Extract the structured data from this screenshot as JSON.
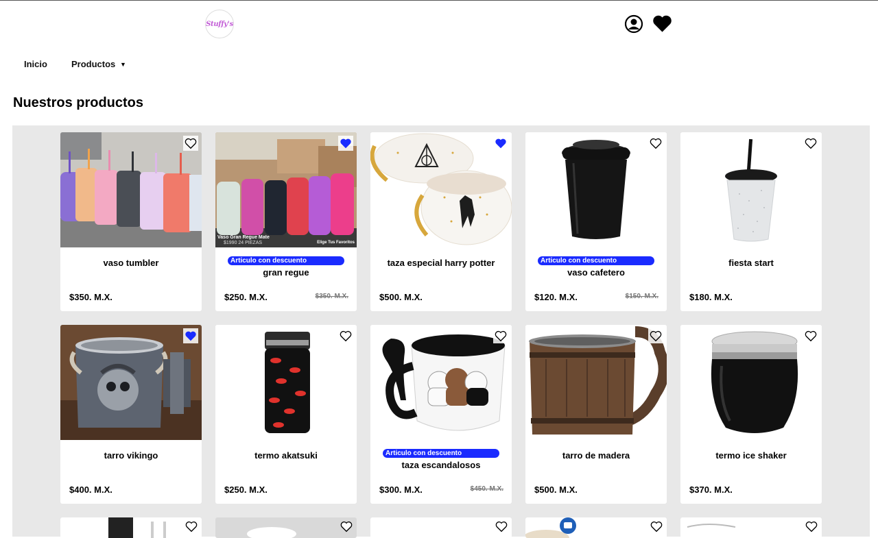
{
  "header": {
    "logo_text": "Stuffy's",
    "icons": [
      "user-circle-icon",
      "heart-icon"
    ]
  },
  "nav": {
    "inicio": "Inicio",
    "productos": "Productos",
    "caret": "▼"
  },
  "page_title": "Nuestros productos",
  "products": [
    {
      "name": "vaso tumbler",
      "price": "$350. M.X.",
      "favorite": false,
      "discount": false
    },
    {
      "name": "gran regue",
      "price": "$250. M.X.",
      "old_price": "$350. M.X.",
      "favorite": true,
      "discount": true,
      "badge": "Articulo con descuento",
      "img_caption": "Vaso Gran Regue Mate",
      "img_sub": "$1990 24 PIEZAS",
      "img_tag": "Elige Tus Favoritos"
    },
    {
      "name": "taza especial harry potter",
      "price": "$500. M.X.",
      "favorite": true,
      "discount": false
    },
    {
      "name": "vaso cafetero",
      "price": "$120. M.X.",
      "old_price": "$150. M.X.",
      "favorite": false,
      "discount": true,
      "badge": "Articulo con descuento"
    },
    {
      "name": "fiesta start",
      "price": "$180. M.X.",
      "favorite": false,
      "discount": false
    },
    {
      "name": "tarro vikingo",
      "price": "$400. M.X.",
      "favorite": true,
      "discount": false
    },
    {
      "name": "termo akatsuki",
      "price": "$250. M.X.",
      "favorite": false,
      "discount": false
    },
    {
      "name": "taza escandalosos",
      "price": "$300. M.X.",
      "old_price": "$450. M.X.",
      "favorite": false,
      "discount": true,
      "badge": "Articulo con descuento"
    },
    {
      "name": "tarro de madera",
      "price": "$500. M.X.",
      "favorite": false,
      "discount": false
    },
    {
      "name": "termo ice shaker",
      "price": "$370. M.X.",
      "favorite": false,
      "discount": false
    }
  ],
  "colors": {
    "accent_blue": "#1a2bff",
    "favorite_blue": "#1a2bff",
    "grid_background": "#e8e8e8"
  }
}
